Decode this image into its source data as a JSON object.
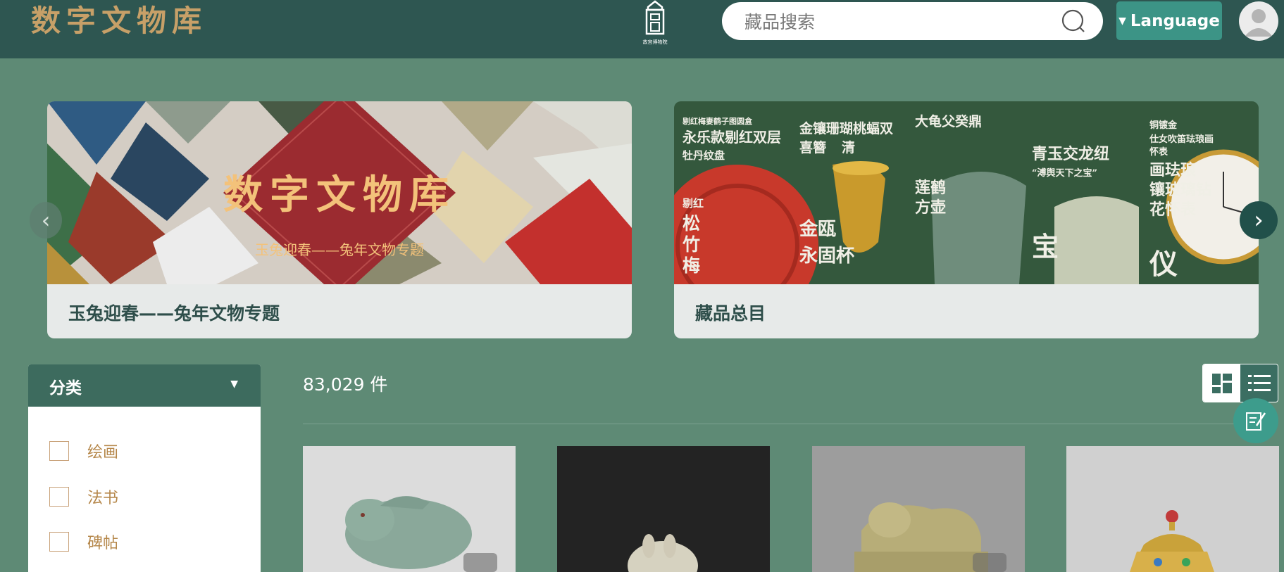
{
  "header": {
    "logo_text": "数字文物库",
    "museum_caption": "故宫博物院",
    "search": {
      "placeholder": "藏品搜索",
      "value": ""
    },
    "language_label": "Language"
  },
  "banners": [
    {
      "title": "数字文物库",
      "subtitle": "玉兔迎春——兔年文物专题",
      "caption": "玉兔迎春——兔年文物专题"
    },
    {
      "caption": "藏品总目",
      "overlay_texts": [
        "剔红梅妻鹤子图圆盒",
        "永乐款剔红双层",
        "牡丹纹盘",
        "剔红",
        "松",
        "竹",
        "梅",
        "金镶珊瑚桃蝠双",
        "喜簪",
        "清",
        "金瓯",
        "永固杯",
        "大龟父癸鼎",
        "莲鹤",
        "方壶",
        "青玉交龙纽",
        "“溥舆天下之宝”",
        "宝",
        "铜镀金",
        "仕女吹笛珐琅画",
        "怀表",
        "画珐琅",
        "镶玻璃钻",
        "花怀表",
        "仪"
      ]
    }
  ],
  "filter": {
    "title": "分类",
    "items": [
      "绘画",
      "法书",
      "碑帖"
    ]
  },
  "results": {
    "count": "83,029 件"
  },
  "colors": {
    "page_bg": "#5e8a75",
    "header_bg": "#2e5651",
    "accent": "#3c9486",
    "gold": "#c7a068"
  },
  "icons": [
    "search-icon",
    "caret-down-icon",
    "user-avatar-icon",
    "chevron-left-icon",
    "chevron-right-icon",
    "grid-view-icon",
    "list-view-icon",
    "note-edit-icon",
    "museum-store-icon"
  ]
}
